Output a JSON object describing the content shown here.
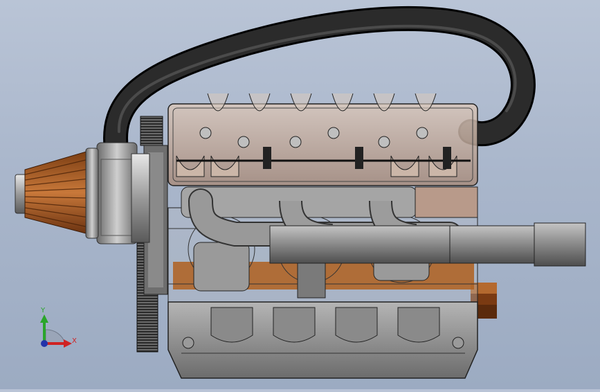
{
  "app": {
    "view": "front"
  },
  "colors": {
    "background_top": "#b9c4d6",
    "background_bottom": "#9cabc2",
    "hose": "#1e1e1e",
    "filter_copper": "#b8642a",
    "metal": "#8c8c8c",
    "valve_cover": "#c9b4a6",
    "axis_y": "#2aa52a",
    "axis_x": "#d02222",
    "axis_origin": "#2233aa"
  },
  "triad": {
    "y_label": "Y",
    "x_label": "X"
  },
  "model": {
    "parts": [
      "air-filter",
      "turbo-housing",
      "intake-hose",
      "valve-cover",
      "cylinder-head",
      "exhaust-manifold",
      "exhaust-pipe",
      "engine-block",
      "oil-pan",
      "flywheel",
      "timing-pulley",
      "crank-pulley"
    ]
  }
}
